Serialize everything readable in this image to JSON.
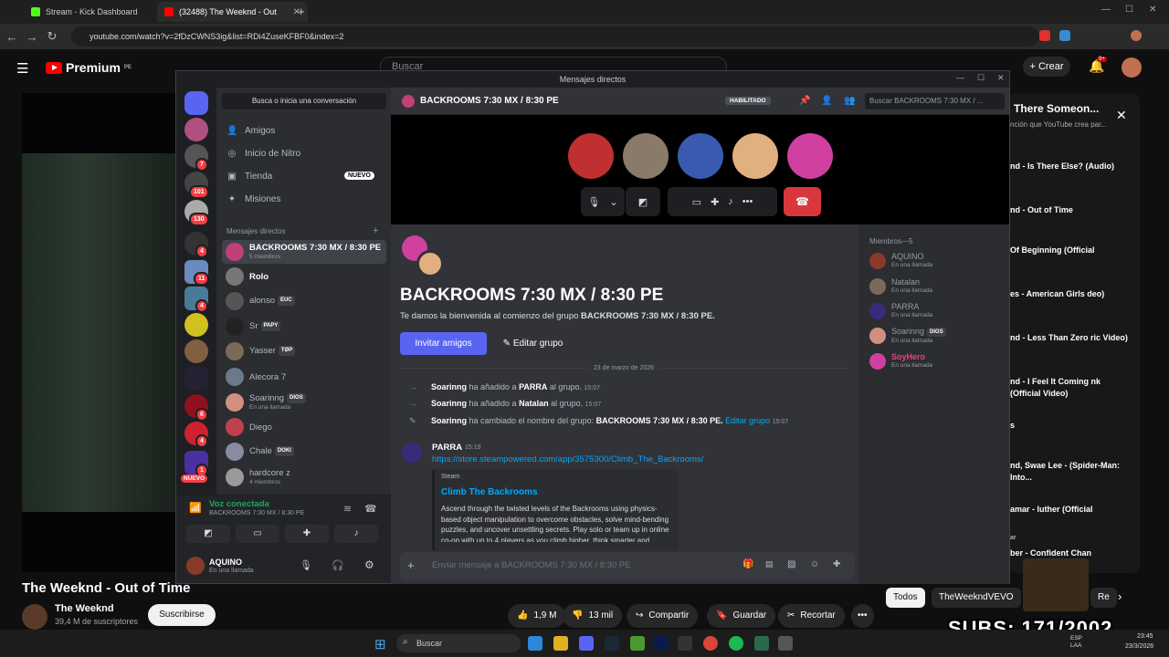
{
  "browser": {
    "tabs": [
      {
        "title": "Stream - Kick Dashboard",
        "favicon_color": "#53fc18"
      },
      {
        "title": "(32488) The Weeknd - Out",
        "favicon_color": "#ff0000"
      }
    ],
    "url": "youtube.com/watch?v=2fDzCWNS3ig&list=RDi4ZuseKFBF0&index=2"
  },
  "youtube": {
    "logo": "Premium",
    "logo_badge": "PE",
    "search_placeholder": "Buscar",
    "create_label": "Crear",
    "notif_badge": "9+",
    "video_title": "The Weeknd - Out of Time",
    "channel": "The Weeknd",
    "subscribers": "39,4 M de suscriptores",
    "subscribe_label": "Suscribirse",
    "likes": "1,9 M",
    "dislikes": "13 mil",
    "share": "Compartir",
    "save": "Guardar",
    "clip": "Recortar",
    "chips": [
      "Todos",
      "TheWeekndVEVO",
      "Re"
    ],
    "playlist": {
      "title": "There Someon...",
      "subtitle": "nción que YouTube crea par...",
      "items": [
        "nd - Is There Else? (Audio)",
        "nd - Out of Time",
        "Of Beginning (Official",
        "es - American Girls deo)",
        "nd - Less Than Zero ric Video)",
        "nd - I Feel It Coming nk (Official Video)",
        "s",
        "nd, Swae Lee - (Spider-Man: Into...",
        "amar - luther (Official",
        "ar",
        "ber - Confident Chan"
      ]
    }
  },
  "discord": {
    "window_title": "Mensajes directos",
    "dm_search": "Busca o inicia una conversación",
    "nav": [
      "Amigos",
      "Inicio de Nitro",
      "Tienda",
      "Misiones"
    ],
    "nuevo": "NUEVO",
    "dm_header": "Mensajes directos",
    "guild_badges": [
      "7",
      "101",
      "130",
      "4",
      "11",
      "4",
      "6",
      "4",
      "1"
    ],
    "guild_nuevo": "NUEVO",
    "dms": [
      {
        "name": "BACKROOMS 7:30 MX / 8:30 PE",
        "sub": "5 miembros",
        "color": "#c0407a"
      },
      {
        "name": "Rolo",
        "sub": "",
        "color": "#777"
      },
      {
        "name": "alonso",
        "tag": "EUC",
        "sub": "",
        "color": "#555"
      },
      {
        "name": "Sr",
        "tag": "PAPY",
        "sub": "",
        "color": "#222"
      },
      {
        "name": "Yasser",
        "tag": "TØP",
        "sub": "",
        "color": "#7a6a5a"
      },
      {
        "name": "Alecora 7",
        "sub": "",
        "color": "#6a7a8a"
      },
      {
        "name": "Soarinng",
        "tag": "DIOS",
        "sub": "En una llamada",
        "color": "#d09080"
      },
      {
        "name": "Diego",
        "sub": "",
        "color": "#c04050"
      },
      {
        "name": "Chale",
        "tag": "DOKI",
        "sub": "",
        "color": "#8a8aa0"
      },
      {
        "name": "hardcore z",
        "sub": "4 miembros",
        "color": "#9a9a9a"
      }
    ],
    "voice_connected": "Voz conectada",
    "voice_channel": "BACKROOMS 7:30 MX / 8:30 PE",
    "user": {
      "name": "AQUINO",
      "status": "En una llamada"
    },
    "channel_name": "BACKROOMS 7:30 MX / 8:30 PE",
    "habilitado": "HABILITADO",
    "channel_search": "Buscar BACKROOMS 7:30 MX / ...",
    "call_avatars": [
      "#c03030",
      "#8a7a6a",
      "#3a5ab0",
      "#e0b080",
      "#d040a0"
    ],
    "big_title": "BACKROOMS 7:30 MX / 8:30 PE",
    "welcome_text": "Te damos la bienvenida al comienzo del grupo ",
    "welcome_bold": "BACKROOMS 7:30 MX / 8:30 PE.",
    "invite_label": "Invitar amigos",
    "edit_label": "Editar grupo",
    "date": "23 de marzo de 2026",
    "sys": [
      {
        "a": "Soarinng",
        "t": " ha añadido a ",
        "b": "PARRA",
        "c": " al grupo.",
        "time": "15:07"
      },
      {
        "a": "Soarinng",
        "t": " ha añadido a ",
        "b": "Natalan",
        "c": " al grupo.",
        "time": "15:07"
      },
      {
        "a": "Soarinng",
        "t": " ha cambiado el nombre del grupo: ",
        "b": "BACKROOMS 7:30 MX / 8:30 PE.",
        "c": " Editar grupo",
        "time": "15:07"
      }
    ],
    "msg": {
      "author": "PARRA",
      "time": "15:19",
      "link": "https://store.steampowered.com/app/3575300/Climb_The_Backrooms/",
      "embed_src": "Steam",
      "embed_title": "Climb The Backrooms",
      "embed_desc": "Ascend through the twisted levels of the Backrooms using physics-based object manipulation to overcome obstacles, solve mind-bending puzzles, and uncover unsettling secrets. Play solo or team up in online co-op with up to 4 players as you climb higher, think smarter and survive the unknown."
    },
    "message_placeholder": "Enviar mensaje a BACKROOMS 7:30 MX / 8:30 PE",
    "members_header": "Miembros—5",
    "members": [
      {
        "name": "AQUINO",
        "status": "En una llamada",
        "color": "#8a3a2a"
      },
      {
        "name": "Natalan",
        "status": "En una llamada",
        "color": "#7a6a5a"
      },
      {
        "name": "PARRA",
        "status": "En una llamada",
        "color": "#3a2a7a"
      },
      {
        "name": "Soarinng",
        "tag": "DIOS",
        "status": "En una llamada",
        "color": "#d09080"
      },
      {
        "name": "SoyHero",
        "status": "En una llamada",
        "color": "#d040a0"
      }
    ]
  },
  "taskbar": {
    "search": "Buscar",
    "lang": "ESP LAA",
    "time": "23:45",
    "date": "23/3/2026"
  },
  "overlay": {
    "subs": "SUBS: 171/2002"
  }
}
